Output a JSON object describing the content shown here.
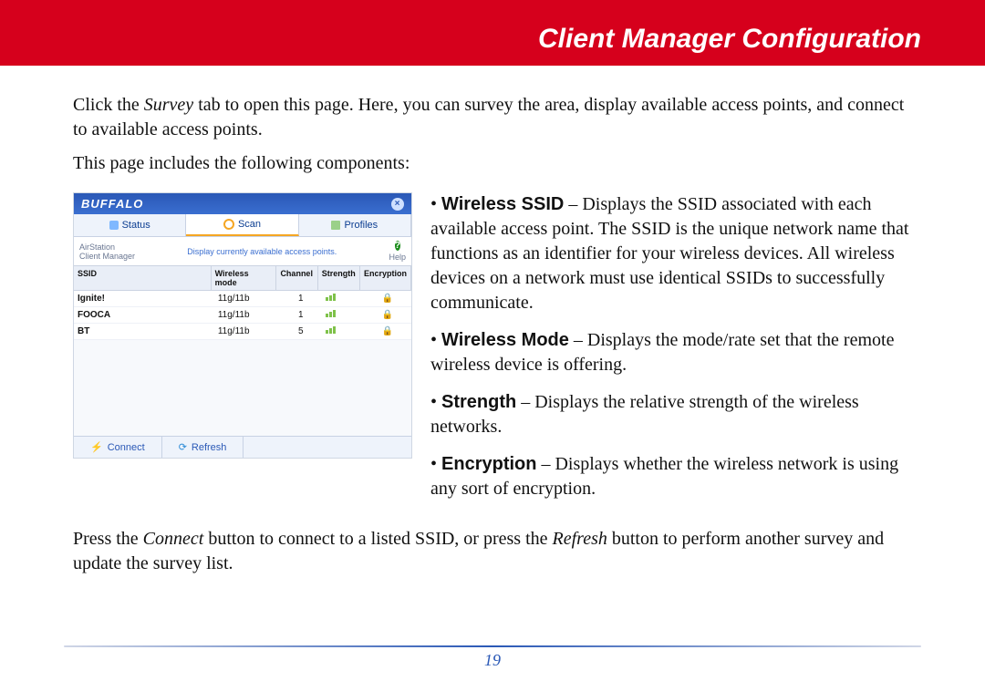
{
  "header": {
    "title": "Client Manager Configuration"
  },
  "intro1_a": "Click the ",
  "intro1_em": "Survey",
  "intro1_b": " tab to open this page. Here, you can survey the area, display available access points, and connect to available access points.",
  "intro2": "This page includes the following components:",
  "screenshot": {
    "brand": "BUFFALO",
    "tabs": {
      "status": "Status",
      "scan": "Scan",
      "profiles": "Profiles"
    },
    "corner_label_top": "AirStation",
    "corner_label_bottom": "Client Manager",
    "status_text": "Display currently available access points.",
    "help": "Help",
    "columns": {
      "ssid": "SSID",
      "mode": "Wireless mode",
      "channel": "Channel",
      "strength": "Strength",
      "encryption": "Encryption"
    },
    "rows": [
      {
        "ssid": "Ignite!",
        "mode": "11g/11b",
        "channel": "1"
      },
      {
        "ssid": "FOOCA",
        "mode": "11g/11b",
        "channel": "1"
      },
      {
        "ssid": "BT",
        "mode": "11g/11b",
        "channel": "5"
      }
    ],
    "buttons": {
      "connect": "Connect",
      "refresh": "Refresh"
    }
  },
  "bullets": {
    "b1_t": "Wireless SSID",
    "b1_d": " – Displays the SSID associated with each available access point. The SSID is the unique network name that functions as an identifier for your wireless devices. All wireless devices on a network must use identical SSIDs to successfully communicate.",
    "b2_t": "Wireless Mode",
    "b2_d": " – Displays the mode/rate set that the remote wireless device is offering.",
    "b3_t": "Strength",
    "b3_d": " – Displays the relative strength of the wireless networks.",
    "b4_t": "Encryption",
    "b4_d": " – Displays whether the wireless network is using any sort of encryption."
  },
  "footer_a": "Press the ",
  "footer_em1": "Connect",
  "footer_b": " button to connect to a listed SSID, or press the ",
  "footer_em2": "Refresh",
  "footer_c": " button to perform another survey and update the survey list.",
  "page_number": "19"
}
